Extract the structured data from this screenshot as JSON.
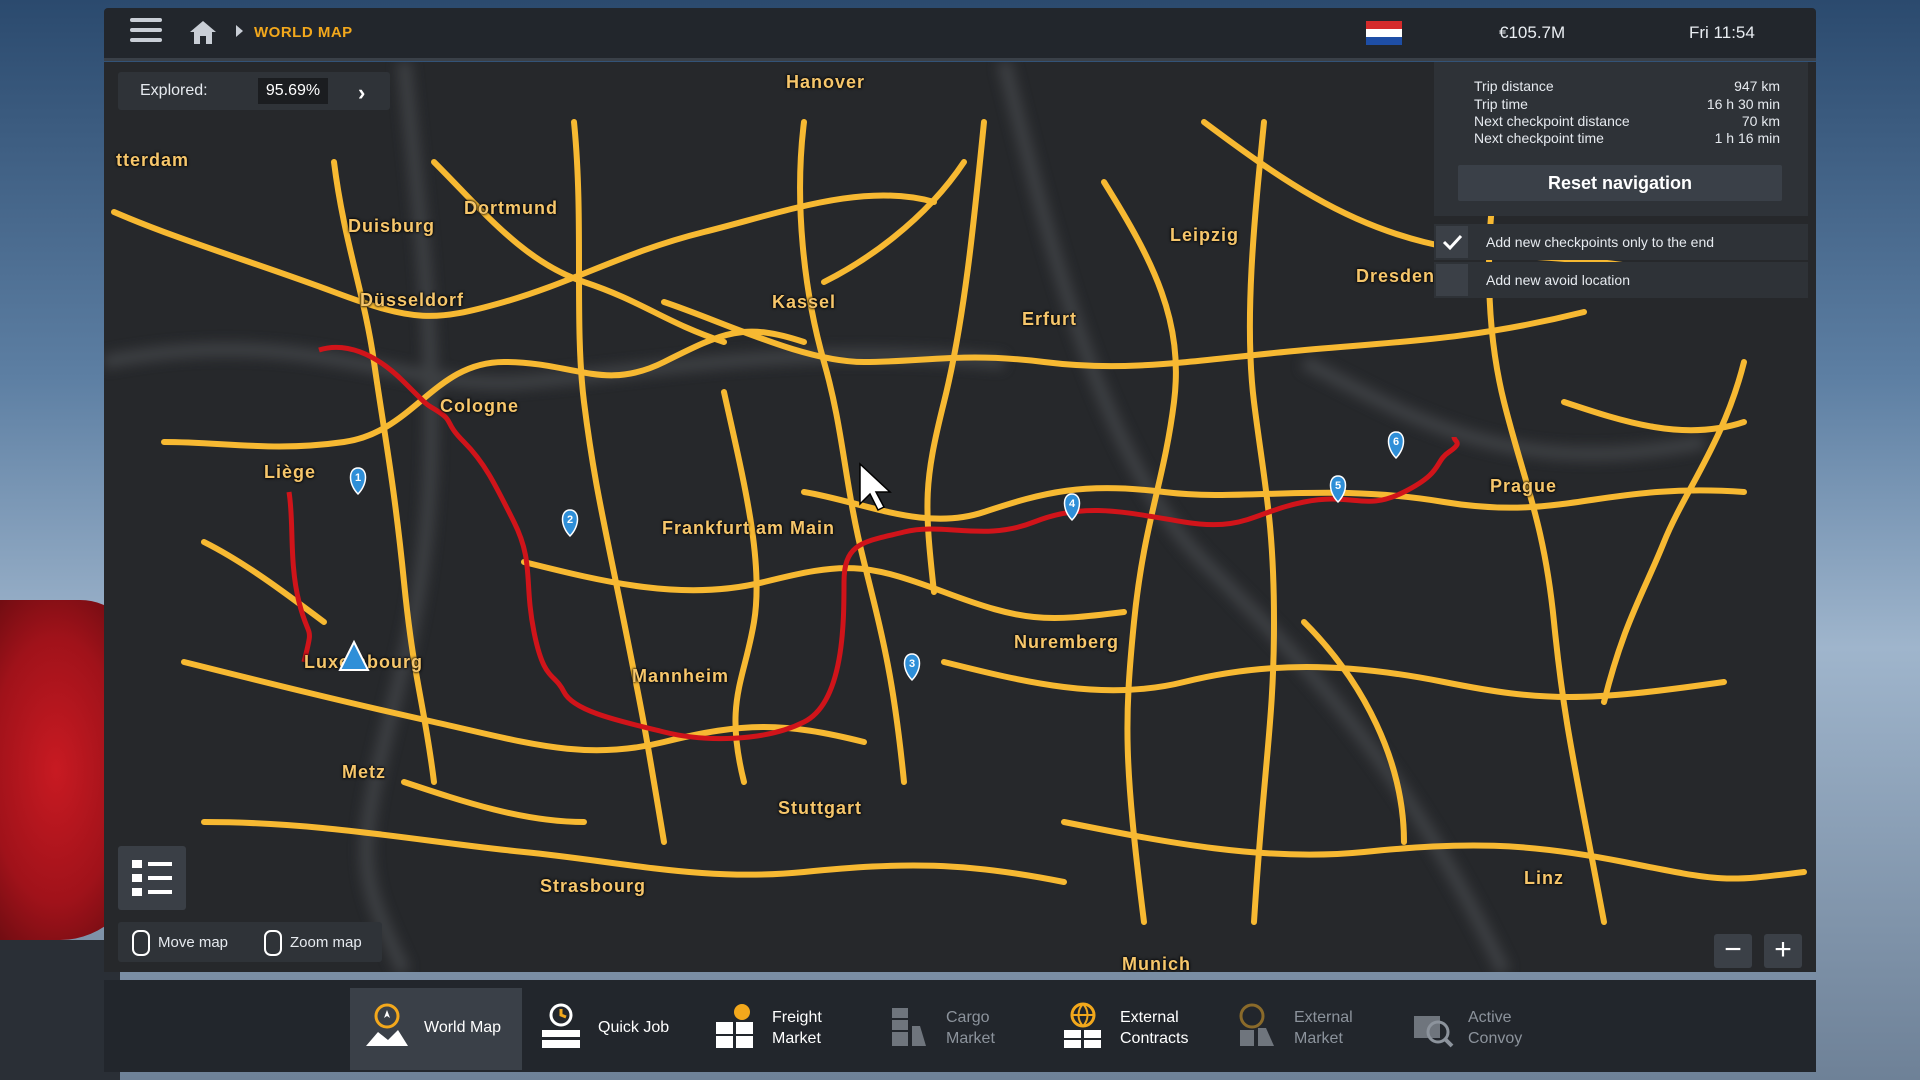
{
  "topbar": {
    "breadcrumb": "WORLD MAP",
    "money": "€105.7M",
    "clock": "Fri 11:54"
  },
  "explored": {
    "label": "Explored:",
    "value": "95.69%"
  },
  "cities": [
    {
      "name": "Hanover"
    },
    {
      "name": "tterdam"
    },
    {
      "name": "Duisburg"
    },
    {
      "name": "Dortmund"
    },
    {
      "name": "Leipzig"
    },
    {
      "name": "Düsseldorf"
    },
    {
      "name": "Kassel"
    },
    {
      "name": "Erfurt"
    },
    {
      "name": "Dresden"
    },
    {
      "name": "Cologne"
    },
    {
      "name": "Liège"
    },
    {
      "name": "Prague"
    },
    {
      "name": "Frankfurt am Main"
    },
    {
      "name": "Nuremberg"
    },
    {
      "name": "Luxembourg"
    },
    {
      "name": "Mannheim"
    },
    {
      "name": "Metz"
    },
    {
      "name": "Stuttgart"
    },
    {
      "name": "Strasbourg"
    },
    {
      "name": "Linz"
    },
    {
      "name": "Munich"
    }
  ],
  "navigation": {
    "trip_distance_label": "Trip distance",
    "trip_distance": "947 km",
    "trip_time_label": "Trip time",
    "trip_time": "16 h 30 min",
    "next_cp_distance_label": "Next checkpoint distance",
    "next_cp_distance": "70 km",
    "next_cp_time_label": "Next checkpoint time",
    "next_cp_time": "1 h 16 min",
    "reset_label": "Reset navigation",
    "option1_label": "Add new checkpoints only to the end",
    "option1_checked": true,
    "option2_label": "Add new avoid location",
    "option2_checked": false
  },
  "controls": {
    "move_map": "Move map",
    "zoom_map": "Zoom map"
  },
  "waypoints": [
    "1",
    "2",
    "3",
    "4",
    "5",
    "6"
  ],
  "tabs": [
    {
      "line1": "World Map",
      "line2": "",
      "active": true,
      "dim": false,
      "icon": "world-map-icon"
    },
    {
      "line1": "Quick Job",
      "line2": "",
      "active": false,
      "dim": false,
      "icon": "quick-job-icon"
    },
    {
      "line1": "Freight",
      "line2": "Market",
      "active": false,
      "dim": false,
      "icon": "freight-market-icon"
    },
    {
      "line1": "Cargo",
      "line2": "Market",
      "active": false,
      "dim": true,
      "icon": "cargo-market-icon"
    },
    {
      "line1": "External",
      "line2": "Contracts",
      "active": false,
      "dim": false,
      "icon": "external-contracts-icon"
    },
    {
      "line1": "External",
      "line2": "Market",
      "active": false,
      "dim": true,
      "icon": "external-market-icon"
    },
    {
      "line1": "Active",
      "line2": "Convoy",
      "active": false,
      "dim": true,
      "icon": "active-convoy-icon"
    }
  ],
  "colors": {
    "road": "#f7b932",
    "route": "#d0141a",
    "accent": "#f3a81c",
    "waypoint": "#2f8fd8"
  }
}
